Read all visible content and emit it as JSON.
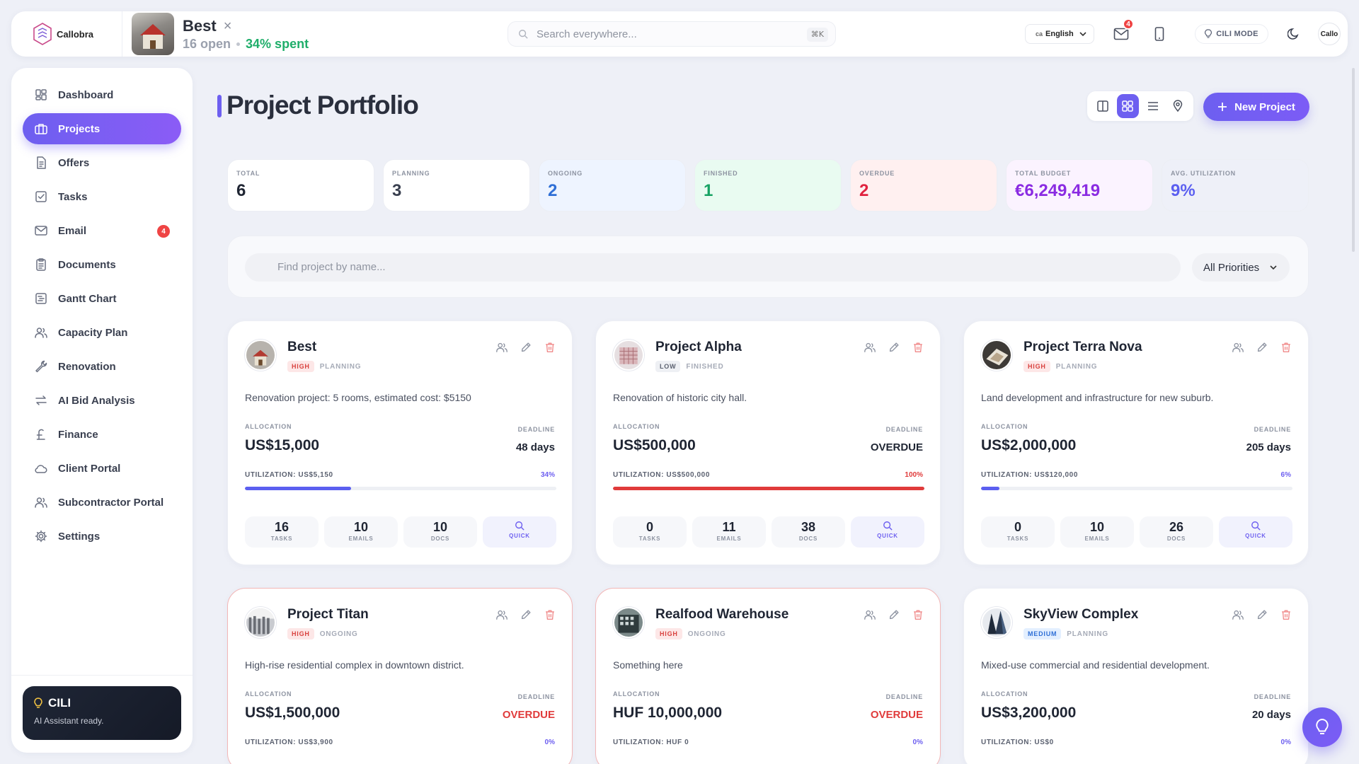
{
  "topbar": {
    "brand": "Callobra",
    "project_name": "Best",
    "open_count": "16 open",
    "spent": "34% spent",
    "search_placeholder": "Search everywhere...",
    "search_shortcut": "⌘K",
    "language": "English",
    "language_flag": "ca",
    "mail_badge": "4",
    "cili_mode": "CILI MODE",
    "user_label": "Callo"
  },
  "sidebar": {
    "items": [
      {
        "label": "Dashboard",
        "icon": "dashboard-icon"
      },
      {
        "label": "Projects",
        "icon": "briefcase-icon",
        "active": true
      },
      {
        "label": "Offers",
        "icon": "document-icon"
      },
      {
        "label": "Tasks",
        "icon": "checkbox-icon"
      },
      {
        "label": "Email",
        "icon": "mail-icon",
        "badge": "4"
      },
      {
        "label": "Documents",
        "icon": "clipboard-icon"
      },
      {
        "label": "Gantt Chart",
        "icon": "gantt-icon"
      },
      {
        "label": "Capacity Plan",
        "icon": "users-icon"
      },
      {
        "label": "Renovation",
        "icon": "wrench-icon"
      },
      {
        "label": "AI Bid Analysis",
        "icon": "arrows-icon"
      },
      {
        "label": "Finance",
        "icon": "pound-icon"
      },
      {
        "label": "Client Portal",
        "icon": "cloud-icon"
      },
      {
        "label": "Subcontractor Portal",
        "icon": "users-icon"
      },
      {
        "label": "Settings",
        "icon": "gear-icon"
      }
    ],
    "assistant": {
      "title": "CILI",
      "subtitle": "AI Assistant ready."
    }
  },
  "main": {
    "title": "Project Portfolio",
    "new_project": "New Project",
    "stats": [
      {
        "label": "TOTAL",
        "value": "6",
        "color": "#1f2533",
        "bg": "#ffffff"
      },
      {
        "label": "PLANNING",
        "value": "3",
        "color": "#3a4050",
        "bg": "#ffffff"
      },
      {
        "label": "ONGOING",
        "value": "2",
        "color": "#2f6fd6",
        "bg": "#eef4ff"
      },
      {
        "label": "FINISHED",
        "value": "1",
        "color": "#16a263",
        "bg": "#e9fbf1"
      },
      {
        "label": "OVERDUE",
        "value": "2",
        "color": "#e0223f",
        "bg": "#fff0f0"
      },
      {
        "label": "TOTAL BUDGET",
        "value": "€6,249,419",
        "color": "#8a2be2",
        "bg": "#fbf3ff"
      },
      {
        "label": "AVG. UTILIZATION",
        "value": "9%",
        "color": "#5b5ff0",
        "bg": "#eef0f8"
      }
    ],
    "search_placeholder": "Find project by name...",
    "priority_filter": "All Priorities"
  },
  "labels": {
    "allocation": "ALLOCATION",
    "deadline": "DEADLINE",
    "tasks": "TASKS",
    "emails": "EMAILS",
    "docs": "DOCS",
    "quick": "QUICK"
  },
  "projects": [
    {
      "name": "Best",
      "priority": "HIGH",
      "status": "PLANNING",
      "description": "Renovation project: 5 rooms, estimated cost: $5150",
      "allocation": "US$15,000",
      "deadline": "48 days",
      "overdue": false,
      "utilization_label": "UTILIZATION: US$5,150",
      "utilization_pct": "34%",
      "utilization": 0.34,
      "tasks": "16",
      "emails": "10",
      "docs": "10"
    },
    {
      "name": "Project Alpha",
      "priority": "LOW",
      "status": "FINISHED",
      "description": "Renovation of historic city hall.",
      "allocation": "US$500,000",
      "deadline": "OVERDUE",
      "overdue": false,
      "utilization_label": "UTILIZATION: US$500,000",
      "utilization_pct": "100%",
      "utilization": 1.0,
      "tasks": "0",
      "emails": "11",
      "docs": "38"
    },
    {
      "name": "Project Terra Nova",
      "priority": "HIGH",
      "status": "PLANNING",
      "description": "Land development and infrastructure for new suburb.",
      "allocation": "US$2,000,000",
      "deadline": "205 days",
      "overdue": false,
      "utilization_label": "UTILIZATION: US$120,000",
      "utilization_pct": "6%",
      "utilization": 0.06,
      "tasks": "0",
      "emails": "10",
      "docs": "26"
    },
    {
      "name": "Project Titan",
      "priority": "HIGH",
      "status": "ONGOING",
      "description": "High-rise residential complex in downtown district.",
      "allocation": "US$1,500,000",
      "deadline": "OVERDUE",
      "overdue": true,
      "utilization_label": "UTILIZATION: US$3,900",
      "utilization_pct": "0%",
      "utilization": 0.0
    },
    {
      "name": "Realfood Warehouse",
      "priority": "HIGH",
      "status": "ONGOING",
      "description": "Something here",
      "allocation": "HUF 10,000,000",
      "deadline": "OVERDUE",
      "overdue": true,
      "utilization_label": "UTILIZATION: HUF 0",
      "utilization_pct": "0%",
      "utilization": 0.0
    },
    {
      "name": "SkyView Complex",
      "priority": "MEDIUM",
      "status": "PLANNING",
      "description": "Mixed-use commercial and residential development.",
      "allocation": "US$3,200,000",
      "deadline": "20 days",
      "overdue": false,
      "utilization_label": "UTILIZATION: US$0",
      "utilization_pct": "0%",
      "utilization": 0.0
    }
  ]
}
